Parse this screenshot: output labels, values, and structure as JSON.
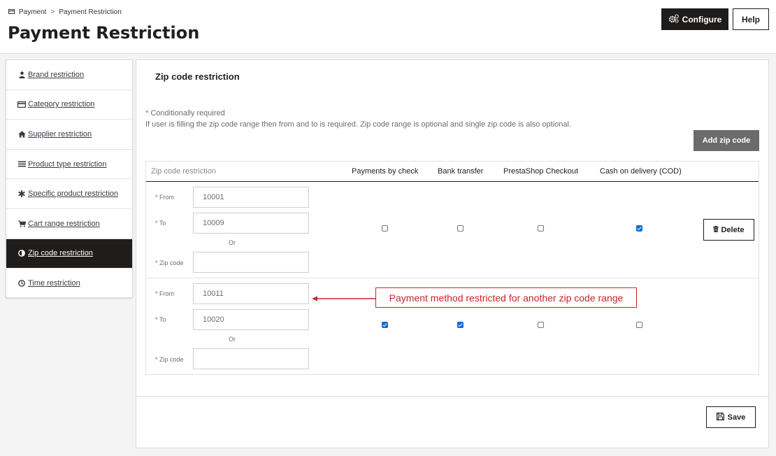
{
  "breadcrumb": {
    "parent": "Payment",
    "separator": ">",
    "current": "Payment Restriction"
  },
  "header": {
    "title": "Payment Restriction",
    "configure_label": "Configure",
    "help_label": "Help"
  },
  "sidebar": {
    "items": [
      {
        "label": "Brand restriction",
        "icon": "user-icon",
        "active": false
      },
      {
        "label": "Category restriction",
        "icon": "card-icon",
        "active": false
      },
      {
        "label": "Supplier restriction",
        "icon": "home-icon",
        "active": false
      },
      {
        "label": "Product type restriction",
        "icon": "list-icon",
        "active": false
      },
      {
        "label": "Specific product restriction",
        "icon": "asterisk-icon",
        "active": false
      },
      {
        "label": "Cart range restriction",
        "icon": "cart-icon",
        "active": false
      },
      {
        "label": "Zip code restriction",
        "icon": "half-circle-icon",
        "active": true
      },
      {
        "label": "Time restriction",
        "icon": "clock-icon",
        "active": false
      }
    ]
  },
  "panel": {
    "title": "Zip code restriction",
    "required_star": "*",
    "required_note": "Conditionally required",
    "info_note": "If user is filling the zip code range then from and to is required. Zip code range is optional and single zip code is also optional.",
    "add_zip_label": "Add zip code",
    "save_label": "Save",
    "delete_label": "Delete"
  },
  "table": {
    "columns": [
      "Zip code restriction",
      "Payments by check",
      "Bank transfer",
      "PrestaShop Checkout",
      "Cash on delivery (COD)"
    ],
    "labels": {
      "from": "* From",
      "to": "* To",
      "or": "Or",
      "zip_code": "* Zip code"
    },
    "rows": [
      {
        "from": "10001",
        "to": "10009",
        "zip_code": "",
        "checks": [
          false,
          false,
          false,
          true
        ]
      },
      {
        "from": "10011",
        "to": "10020",
        "zip_code": "",
        "checks": [
          true,
          true,
          false,
          false
        ]
      }
    ]
  },
  "annotation": {
    "text": "Payment method restricted for another zip code range",
    "color": "#d0202a"
  },
  "colors": {
    "dark": "#1e1d1c",
    "checkbox": "#0a6cd6",
    "add_button": "#6b6b6b"
  }
}
